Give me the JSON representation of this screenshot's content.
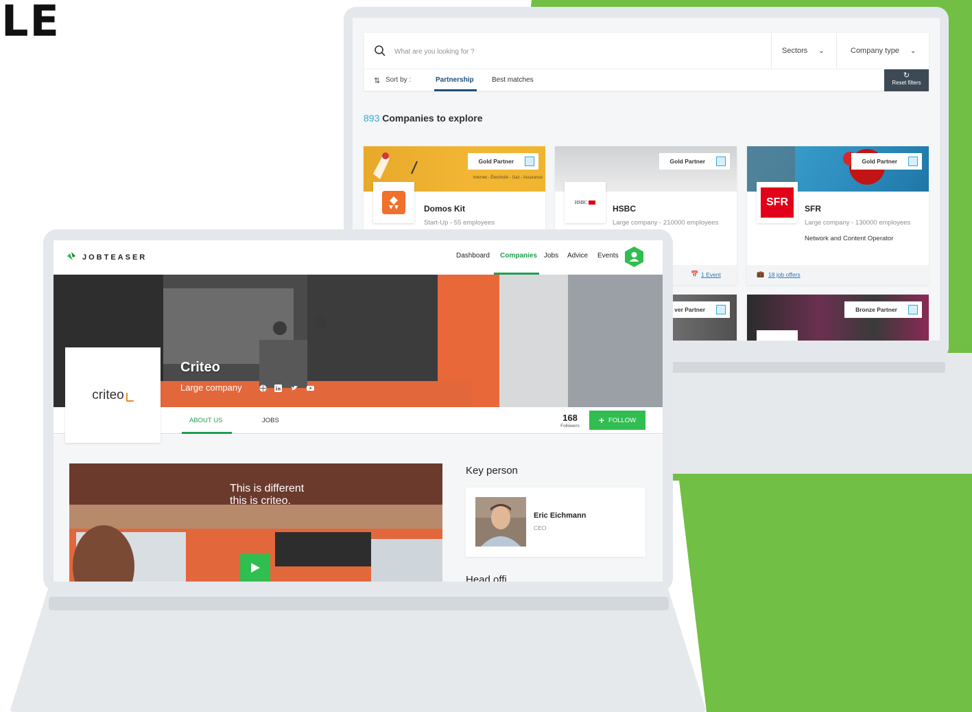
{
  "page": {
    "heading_fragment": "LE",
    "colors": {
      "brand_green": "#71bf44",
      "accent_green": "#2fbe4f",
      "link_blue": "#2f76b8",
      "count_blue": "#33a8d9"
    }
  },
  "directory": {
    "search": {
      "placeholder": "What are you looking for ?",
      "icon": "search-icon"
    },
    "filters": {
      "sectors": "Sectors",
      "company_type": "Company type"
    },
    "sort": {
      "label": "Sort by :",
      "options": [
        "Partnership",
        "Best matches"
      ],
      "active": "Partnership"
    },
    "reset_label": "Reset filters",
    "count": "893",
    "count_label": "Companies to explore",
    "companies": [
      {
        "name": "Domos Kit",
        "meta": "Start-Up - 55 employees",
        "description": "",
        "partner": "Gold Partner",
        "banner_text": "Internet - Électricité - Gaz - Assurance",
        "footer_link": ""
      },
      {
        "name": "HSBC",
        "meta": "Large company - 210000 employees",
        "description": "",
        "partner": "Gold Partner",
        "logo_text": "HSBC",
        "footer_link": "1 Event"
      },
      {
        "name": "SFR",
        "meta": "Large company - 130000 employees",
        "description": "Network and Content Operator",
        "partner": "Gold Partner",
        "logo_text": "SFR",
        "footer_link": "18 job offers"
      }
    ],
    "second_row_badges": [
      "ver Partner",
      "Bronze Partner"
    ]
  },
  "profile": {
    "brand": "JOBTEASER",
    "nav": [
      "Dashboard",
      "Companies",
      "Jobs",
      "Advice",
      "Events"
    ],
    "active_nav": "Companies",
    "company_name": "Criteo",
    "company_type": "Large company",
    "logo_text": "criteo",
    "social_icons": [
      "globe-icon",
      "linkedin-icon",
      "twitter-icon",
      "youtube-icon"
    ],
    "tabs": [
      "ABOUT US",
      "JOBS"
    ],
    "active_tab": "ABOUT US",
    "followers_count": "168",
    "followers_label": "Followers",
    "follow_label": "FOLLOW",
    "video_caption_line1": "This is different",
    "video_caption_line2": "this is criteo.",
    "key_person_title": "Key person",
    "key_person": {
      "name": "Eric Eichmann",
      "role": "CEO"
    },
    "next_section_fragment": "Head offi"
  }
}
